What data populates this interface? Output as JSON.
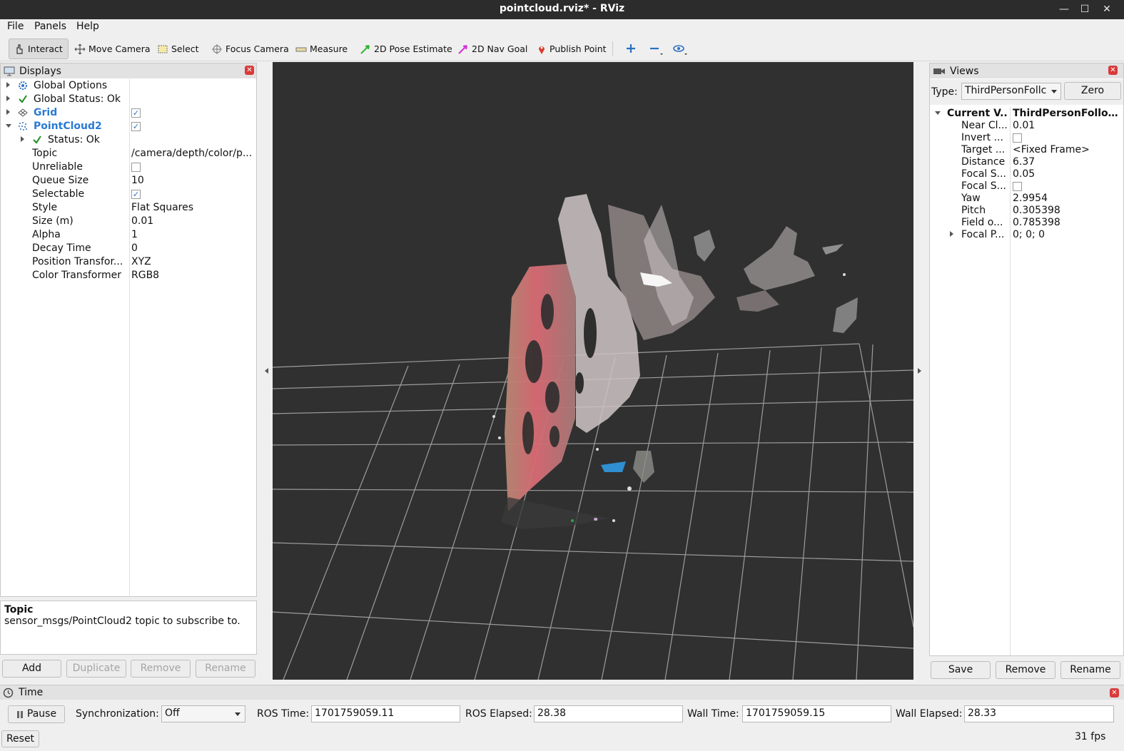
{
  "window": {
    "title": "pointcloud.rviz* - RViz",
    "controls": [
      "—",
      "☐",
      "✕"
    ]
  },
  "menu": [
    "File",
    "Panels",
    "Help"
  ],
  "toolbar": {
    "tools": [
      {
        "label": "Interact",
        "icon": "hand-pointer-icon",
        "active": true
      },
      {
        "label": "Move Camera",
        "icon": "move-camera-icon"
      },
      {
        "label": "Select",
        "icon": "select-box-icon"
      },
      {
        "label": "Focus Camera",
        "icon": "focus-camera-icon"
      },
      {
        "label": "Measure",
        "icon": "ruler-icon"
      },
      {
        "label": "2D Pose Estimate",
        "icon": "green-arrow-icon"
      },
      {
        "label": "2D Nav Goal",
        "icon": "magenta-arrow-icon"
      },
      {
        "label": "Publish Point",
        "icon": "red-pin-icon"
      }
    ]
  },
  "displays": {
    "title": "Displays",
    "items": [
      {
        "name": "Global Options",
        "value": ""
      },
      {
        "name": "Global Status: Ok",
        "value": ""
      },
      {
        "name": "Grid",
        "value": ""
      },
      {
        "name": "PointCloud2",
        "value": ""
      },
      {
        "name": "Status: Ok",
        "value": ""
      },
      {
        "name": "Topic",
        "value": "/camera/depth/color/p..."
      },
      {
        "name": "Unreliable",
        "value": ""
      },
      {
        "name": "Queue Size",
        "value": "10"
      },
      {
        "name": "Selectable",
        "value": ""
      },
      {
        "name": "Style",
        "value": "Flat Squares"
      },
      {
        "name": "Size (m)",
        "value": "0.01"
      },
      {
        "name": "Alpha",
        "value": "1"
      },
      {
        "name": "Decay Time",
        "value": "0"
      },
      {
        "name": "Position Transfor...",
        "value": "XYZ"
      },
      {
        "name": "Color Transformer",
        "value": "RGB8"
      }
    ],
    "help_title": "Topic",
    "help_text": "sensor_msgs/PointCloud2 topic to subscribe to.",
    "buttons": [
      "Add",
      "Duplicate",
      "Remove",
      "Rename"
    ]
  },
  "views": {
    "title": "Views",
    "type_label": "Type:",
    "type_value": "ThirdPersonFollc",
    "zero_label": "Zero",
    "rows": [
      {
        "name": "Current V...",
        "value": "ThirdPersonFollow..."
      },
      {
        "name": "Near Cl...",
        "value": "0.01"
      },
      {
        "name": "Invert ...",
        "value": ""
      },
      {
        "name": "Target ...",
        "value": "<Fixed Frame>"
      },
      {
        "name": "Distance",
        "value": "6.37"
      },
      {
        "name": "Focal S...",
        "value": "0.05"
      },
      {
        "name": "Focal S...",
        "value": ""
      },
      {
        "name": "Yaw",
        "value": "2.9954"
      },
      {
        "name": "Pitch",
        "value": "0.305398"
      },
      {
        "name": "Field o...",
        "value": "0.785398"
      },
      {
        "name": "Focal P...",
        "value": "0; 0; 0"
      }
    ],
    "buttons": [
      "Save",
      "Remove",
      "Rename"
    ]
  },
  "time": {
    "title": "Time",
    "pause_label": "Pause",
    "sync_label": "Synchronization:",
    "sync_value": "Off",
    "ros_time_label": "ROS Time:",
    "ros_time": "1701759059.11",
    "ros_elapsed_label": "ROS Elapsed:",
    "ros_elapsed": "28.38",
    "wall_time_label": "Wall Time:",
    "wall_time": "1701759059.15",
    "wall_elapsed_label": "Wall Elapsed:",
    "wall_elapsed": "28.33",
    "reset_label": "Reset",
    "fps": "31 fps"
  }
}
